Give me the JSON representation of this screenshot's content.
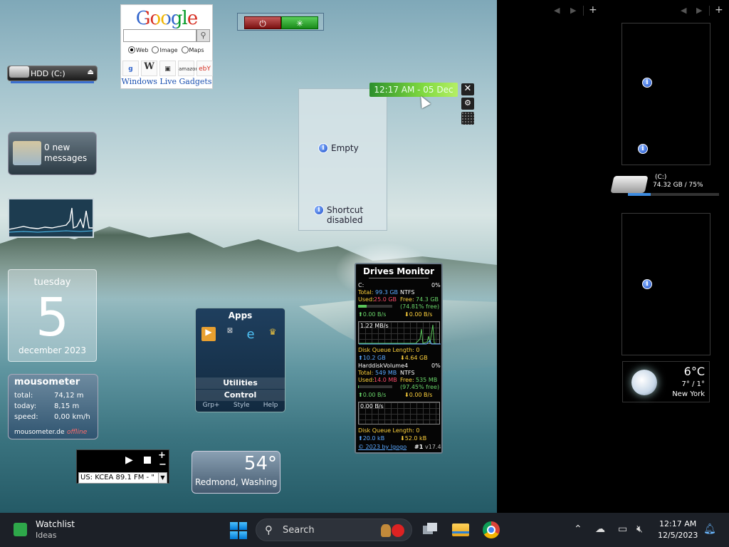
{
  "google": {
    "logo": "Google",
    "search_placeholder": "",
    "search_button_icon": "search-icon",
    "options": [
      "Web",
      "Image",
      "Maps"
    ],
    "selected_option": "Web",
    "shortcuts": [
      "google",
      "wikipedia",
      "youtube",
      "amazon",
      "ebay"
    ],
    "shortcut_labels": {
      "wikipedia": "W",
      "amazon": "amazon",
      "ebay": "ebY"
    },
    "footer_link": "Windows Live Gadgets"
  },
  "hdd": {
    "label": "HDD (C:)",
    "eject_icon": "eject-icon"
  },
  "mail": {
    "line1": "0 new",
    "line2": "messages"
  },
  "calendar": {
    "weekday": "tuesday",
    "day": "5",
    "month_year": "december 2023"
  },
  "mousometer": {
    "title": "mousometer",
    "rows": [
      {
        "label": "total:",
        "value": "74,12 m"
      },
      {
        "label": "today:",
        "value": "8,15 m"
      },
      {
        "label": "speed:",
        "value": "0,00 km/h"
      }
    ],
    "site": "mousometer.de",
    "status": "offline"
  },
  "radio": {
    "station": "US: KCEA 89.1 FM - \""
  },
  "weather_small": {
    "temp": "54°",
    "city": "Redmond, Washing"
  },
  "apps": {
    "title": "Apps",
    "menu": [
      "Utilities",
      "Control"
    ],
    "footer": [
      "Grp+",
      "Style",
      "Help"
    ]
  },
  "empty_gadget": {
    "line1": "Empty",
    "line2a": "Shortcut",
    "line2b": "disabled"
  },
  "clock": {
    "text": "12:17 AM - 05 Dec"
  },
  "drives": {
    "title": "Drives Monitor",
    "d1": {
      "name": "C:",
      "pct": "0%",
      "total_label": "Total:",
      "total": "99.3 GB",
      "fs": "NTFS",
      "used_label": "Used:",
      "used": "25.0 GB",
      "free_label": "Free:",
      "free": "74.3 GB",
      "free_pct": "(74.81% free)",
      "up": "0.00 B/s",
      "down": "0.00 B/s",
      "chart_label": "1.22 MB/s",
      "dql": "Disk Queue Length: 0",
      "read": "10.2 GB",
      "write": "4.64 GB"
    },
    "d2": {
      "name": "HarddiskVolume4",
      "pct": "0%",
      "total_label": "Total:",
      "total": "549 MB",
      "fs": "NTFS",
      "used_label": "Used:",
      "used": "14.0 MB",
      "free_label": "Free:",
      "free": "535 MB",
      "free_pct": "(97.45% free)",
      "up": "0.00 B/s",
      "down": "0.00 B/s",
      "chart_label": "0.00 B/s",
      "dql": "Disk Queue Length: 0",
      "read": "20.0 kB",
      "write": "52.0 kB"
    },
    "footer_link": "© 2023 by Igogo",
    "footer_num": "#1",
    "version": "v17.4"
  },
  "sidebar": {
    "disk_label": "(C:)",
    "disk_info": "74.32 GB / 75%",
    "disk_fill": 0.25,
    "weather": {
      "temp": "6°C",
      "range": "7° / 1°",
      "city": "New York"
    }
  },
  "taskbar": {
    "widget_title": "Watchlist",
    "widget_sub": "Ideas",
    "search_text": "Search",
    "time": "12:17 AM",
    "date": "12/5/2023"
  }
}
